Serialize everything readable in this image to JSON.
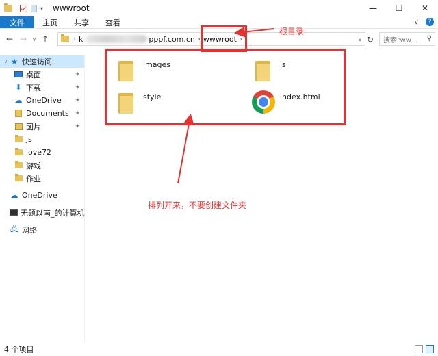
{
  "window": {
    "title": "wwwroot",
    "controls": {
      "minimize": "—",
      "maximize": "☐",
      "close": "✕"
    }
  },
  "ribbon": {
    "tabs": [
      "文件",
      "主页",
      "共享",
      "查看"
    ],
    "expand": "∨",
    "help": "?"
  },
  "address": {
    "back": "←",
    "forward": "→",
    "up_dropdown": "∨",
    "up": "↑",
    "segments": {
      "start": "k",
      "domain_suffix": "pppf.com.cn",
      "current": "wwwroot"
    },
    "refresh": "↻",
    "search_placeholder": "搜索\"ww...",
    "search_icon": "search-icon"
  },
  "nav": {
    "quick_access": "快速访问",
    "quick_items": [
      {
        "label": "桌面",
        "icon": "desktop-icon",
        "pinned": true
      },
      {
        "label": "下载",
        "icon": "download-icon",
        "pinned": true
      },
      {
        "label": "OneDrive",
        "icon": "onedrive-icon",
        "pinned": true
      },
      {
        "label": "Documents",
        "icon": "documents-icon",
        "pinned": true
      },
      {
        "label": "图片",
        "icon": "pictures-icon",
        "pinned": true
      },
      {
        "label": "js",
        "icon": "folder-icon",
        "pinned": false
      },
      {
        "label": "love72",
        "icon": "folder-icon",
        "pinned": false
      },
      {
        "label": "游戏",
        "icon": "folder-icon",
        "pinned": false
      },
      {
        "label": "作业",
        "icon": "folder-icon",
        "pinned": false
      }
    ],
    "onedrive": "OneDrive",
    "this_pc": "无题以南_的计算机",
    "network": "网络",
    "pin_glyph": "📌"
  },
  "files": [
    {
      "name": "images",
      "type": "folder"
    },
    {
      "name": "js",
      "type": "folder"
    },
    {
      "name": "style",
      "type": "folder"
    },
    {
      "name": "index.html",
      "type": "chrome-html"
    }
  ],
  "annotations": {
    "root_label": "根目录",
    "arrange_label": "排列开来，不要创建文件夹",
    "color": "#e8312f"
  },
  "status": {
    "count": "4 个项目"
  },
  "colors": {
    "accent": "#1979ca",
    "selection": "#cce8ff",
    "folder": "#e8c25a"
  }
}
